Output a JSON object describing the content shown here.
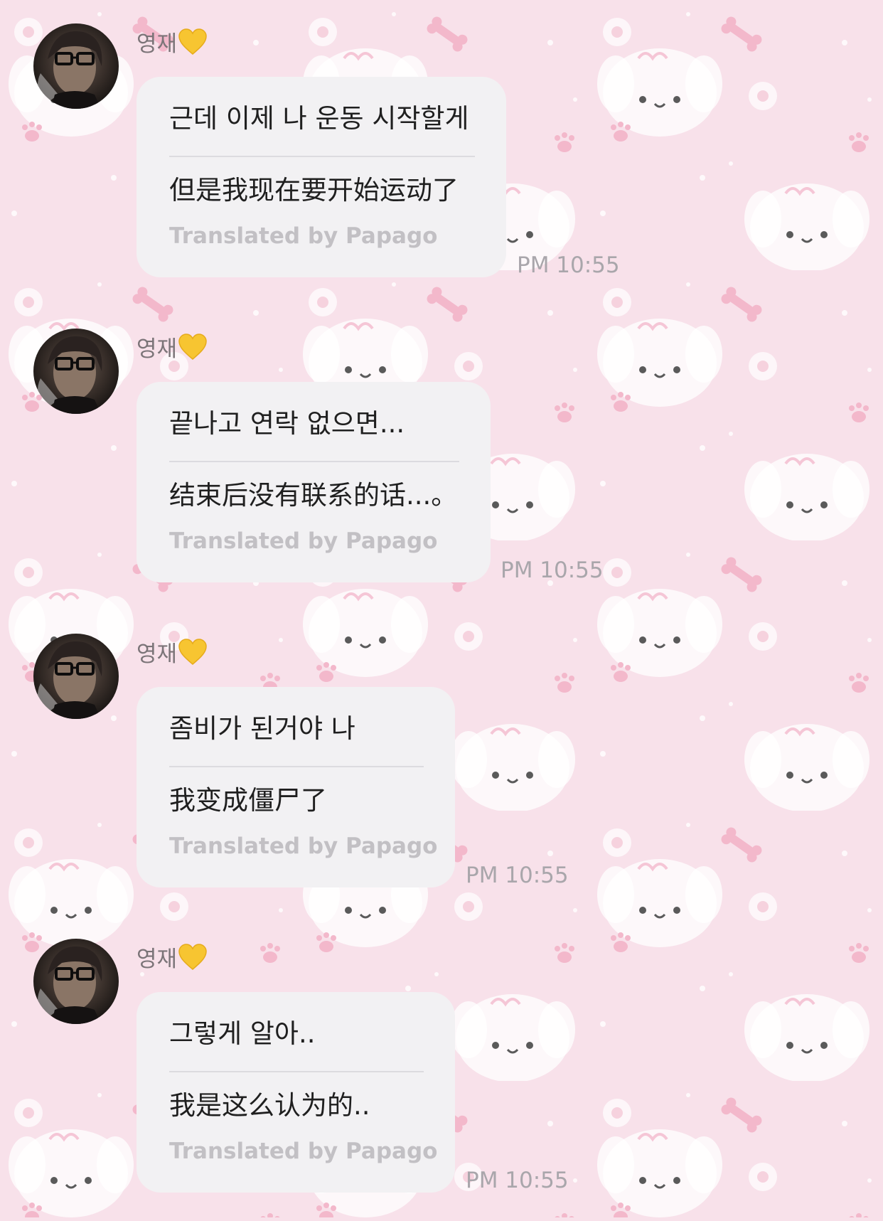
{
  "colors": {
    "background": "#f8e1ea",
    "bubble": "#f2f1f3",
    "heart": "#f7c531"
  },
  "messages": [
    {
      "sender": "영재",
      "sender_icon": "yellow-heart-icon",
      "text": "근데 이제 나 운동 시작할게",
      "translation": "但是我现在要开始运动了",
      "credit": "Translated by Papago",
      "time": "PM 10:55"
    },
    {
      "sender": "영재",
      "sender_icon": "yellow-heart-icon",
      "text": "끝나고 연락 없으면...",
      "translation": "结束后没有联系的话...。",
      "credit": "Translated by Papago",
      "time": "PM 10:55"
    },
    {
      "sender": "영재",
      "sender_icon": "yellow-heart-icon",
      "text": "좀비가 된거야 나",
      "translation": "我变成僵尸了",
      "credit": "Translated by Papago",
      "time": "PM 10:55"
    },
    {
      "sender": "영재",
      "sender_icon": "yellow-heart-icon",
      "text": "그렇게 알아..",
      "translation": "我是这么认为的..",
      "credit": "Translated by Papago",
      "time": "PM 10:55"
    }
  ]
}
